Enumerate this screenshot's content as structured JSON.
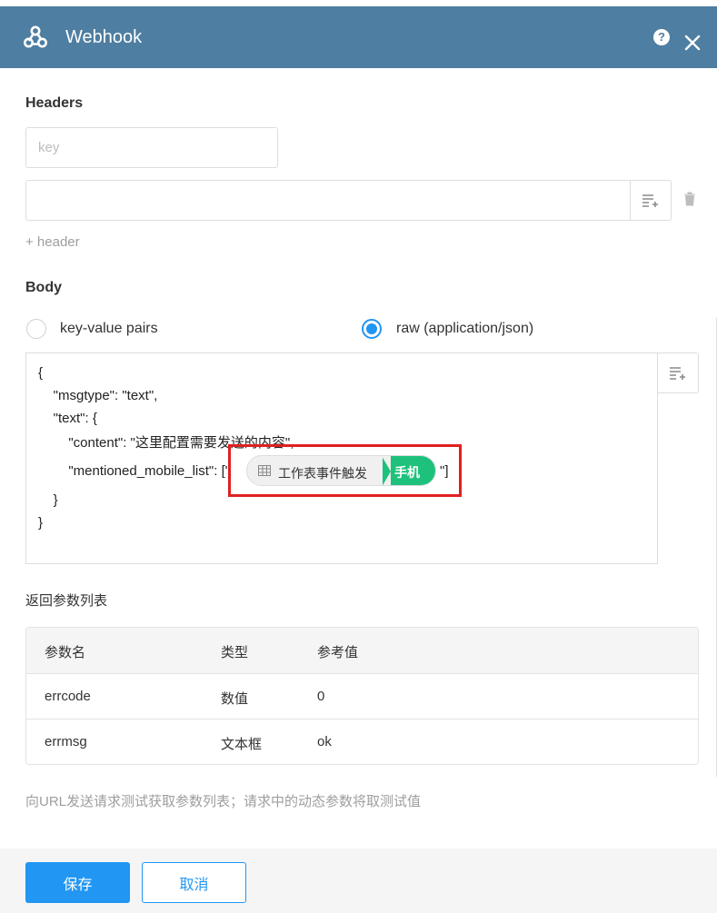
{
  "header": {
    "title": "Webhook",
    "help": "?",
    "bg_color": "#4e7ea1",
    "icons": {
      "logo": "webhook-icon",
      "help": "help-icon",
      "close": "close-icon"
    }
  },
  "headers_section": {
    "title": "Headers",
    "key_placeholder": "key",
    "value": "",
    "add_label": "+ header"
  },
  "body_section": {
    "title": "Body",
    "options": [
      {
        "label": "key-value pairs",
        "checked": false
      },
      {
        "label": "raw (application/json)",
        "checked": true
      }
    ],
    "code_lines": [
      "{",
      "    \"msgtype\": \"text\",",
      "    \"text\": {",
      "        \"content\": \"这里配置需要发送的内容\",",
      "        \"mentioned_mobile_list\": [\"",
      "    }",
      "}"
    ],
    "tag": {
      "source": "工作表事件触发",
      "field": "手机",
      "suffix": "\"]"
    }
  },
  "return_params": {
    "title": "返回参数列表",
    "columns": [
      "参数名",
      "类型",
      "参考值"
    ],
    "rows": [
      [
        "errcode",
        "数值",
        "0"
      ],
      [
        "errmsg",
        "文本框",
        "ok"
      ]
    ]
  },
  "hint": "向URL发送请求测试获取参数列表；请求中的动态参数将取测试值",
  "footer": {
    "save_label": "保存",
    "cancel_label": "取消"
  },
  "colors": {
    "accent": "#2196f3",
    "tag_green": "#1ec17c",
    "highlight": "#e02020"
  }
}
